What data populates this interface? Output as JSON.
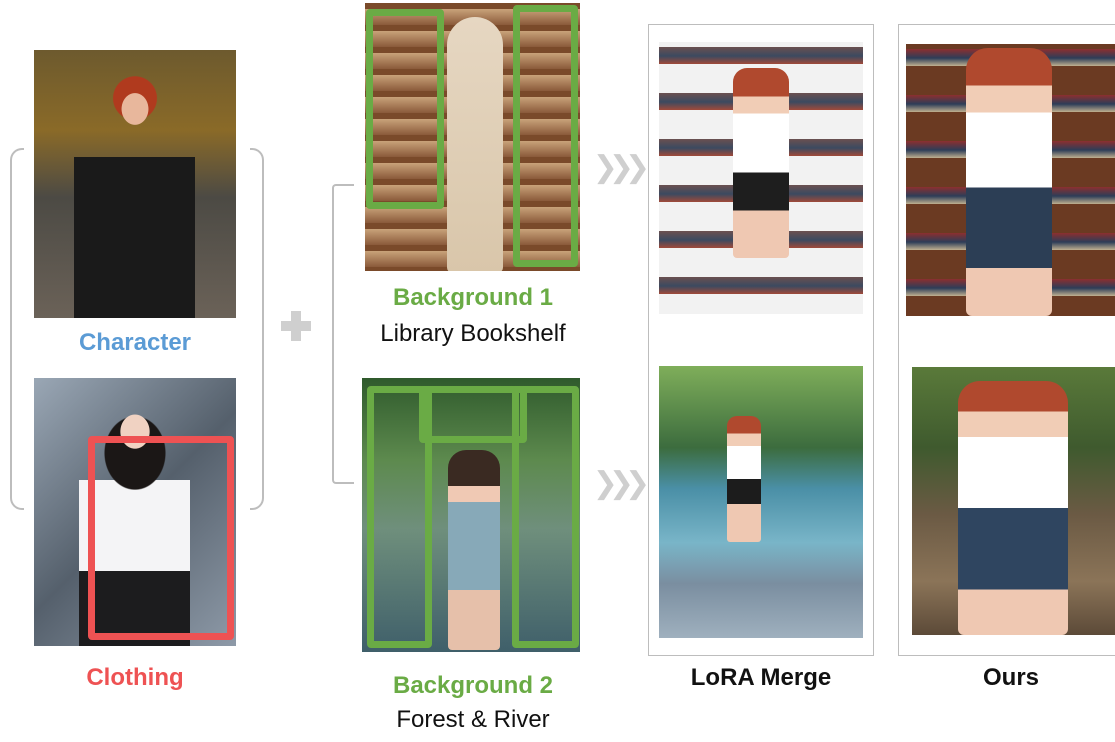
{
  "inputs": {
    "character_label": "Character",
    "clothing_label": "Clothing"
  },
  "backgrounds": [
    {
      "title": "Background 1",
      "subtitle": "Library Bookshelf"
    },
    {
      "title": "Background 2",
      "subtitle": "Forest & River"
    }
  ],
  "outputs": {
    "lora_merge_label": "LoRA Merge",
    "ours_label": "Ours"
  },
  "symbols": {
    "plus": "+",
    "arrow": "❯❯❯"
  },
  "colors": {
    "character": "#5b9bd5",
    "clothing": "#ee5253",
    "background": "#6aab45",
    "text": "#111111",
    "bracket": "#bdbdbd"
  }
}
